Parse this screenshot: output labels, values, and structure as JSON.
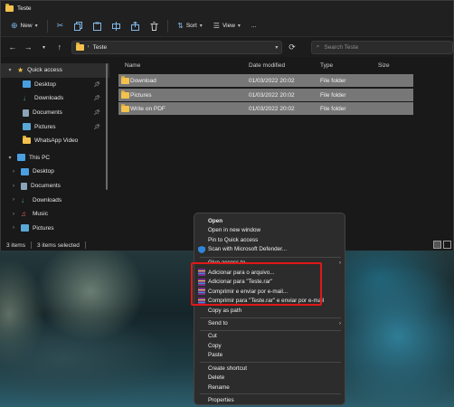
{
  "window": {
    "title": "Teste"
  },
  "toolbar": {
    "new_label": "New",
    "sort_label": "Sort",
    "view_label": "View",
    "more_label": "..."
  },
  "address": {
    "crumb": "Teste",
    "search_placeholder": "Search Teste"
  },
  "nav": {
    "quick_access_label": "Quick access",
    "quick_items": [
      "Desktop",
      "Downloads",
      "Documents",
      "Pictures",
      "WhatsApp Video"
    ],
    "this_pc_label": "This PC",
    "pc_items": [
      "Desktop",
      "Documents",
      "Downloads",
      "Music",
      "Pictures"
    ]
  },
  "columns": {
    "name": "Name",
    "date": "Date modified",
    "type": "Type",
    "size": "Size"
  },
  "files": [
    {
      "name": "Download",
      "date": "01/03/2022 20:02",
      "type": "File folder"
    },
    {
      "name": "Pictures",
      "date": "01/03/2022 20:02",
      "type": "File folder"
    },
    {
      "name": "Write on PDF",
      "date": "01/03/2022 20:02",
      "type": "File folder"
    }
  ],
  "status": {
    "items": "3 items",
    "selected": "3 items selected"
  },
  "context_menu": {
    "open": "Open",
    "open_new_window": "Open in new window",
    "pin_quick": "Pin to Quick access",
    "scan_defender": "Scan with Microsoft Defender...",
    "give_access": "Give access to",
    "winrar_add_archive": "Adicionar para o arquivo...",
    "winrar_add_named": "Adicionar para \"Teste.rar\"",
    "winrar_compress_email": "Comprimir e enviar por e-mail...",
    "winrar_compress_named_email": "Comprimir para \"Teste.rar\" e enviar por e-mail",
    "copy_as_path": "Copy as path",
    "send_to": "Send to",
    "cut": "Cut",
    "copy": "Copy",
    "paste": "Paste",
    "create_shortcut": "Create shortcut",
    "delete": "Delete",
    "rename": "Rename",
    "properties": "Properties"
  },
  "colors": {
    "highlight": "#e01818",
    "folder": "#f3c24c",
    "selection": "#777777",
    "accent_icon": "#7fb7e6"
  }
}
